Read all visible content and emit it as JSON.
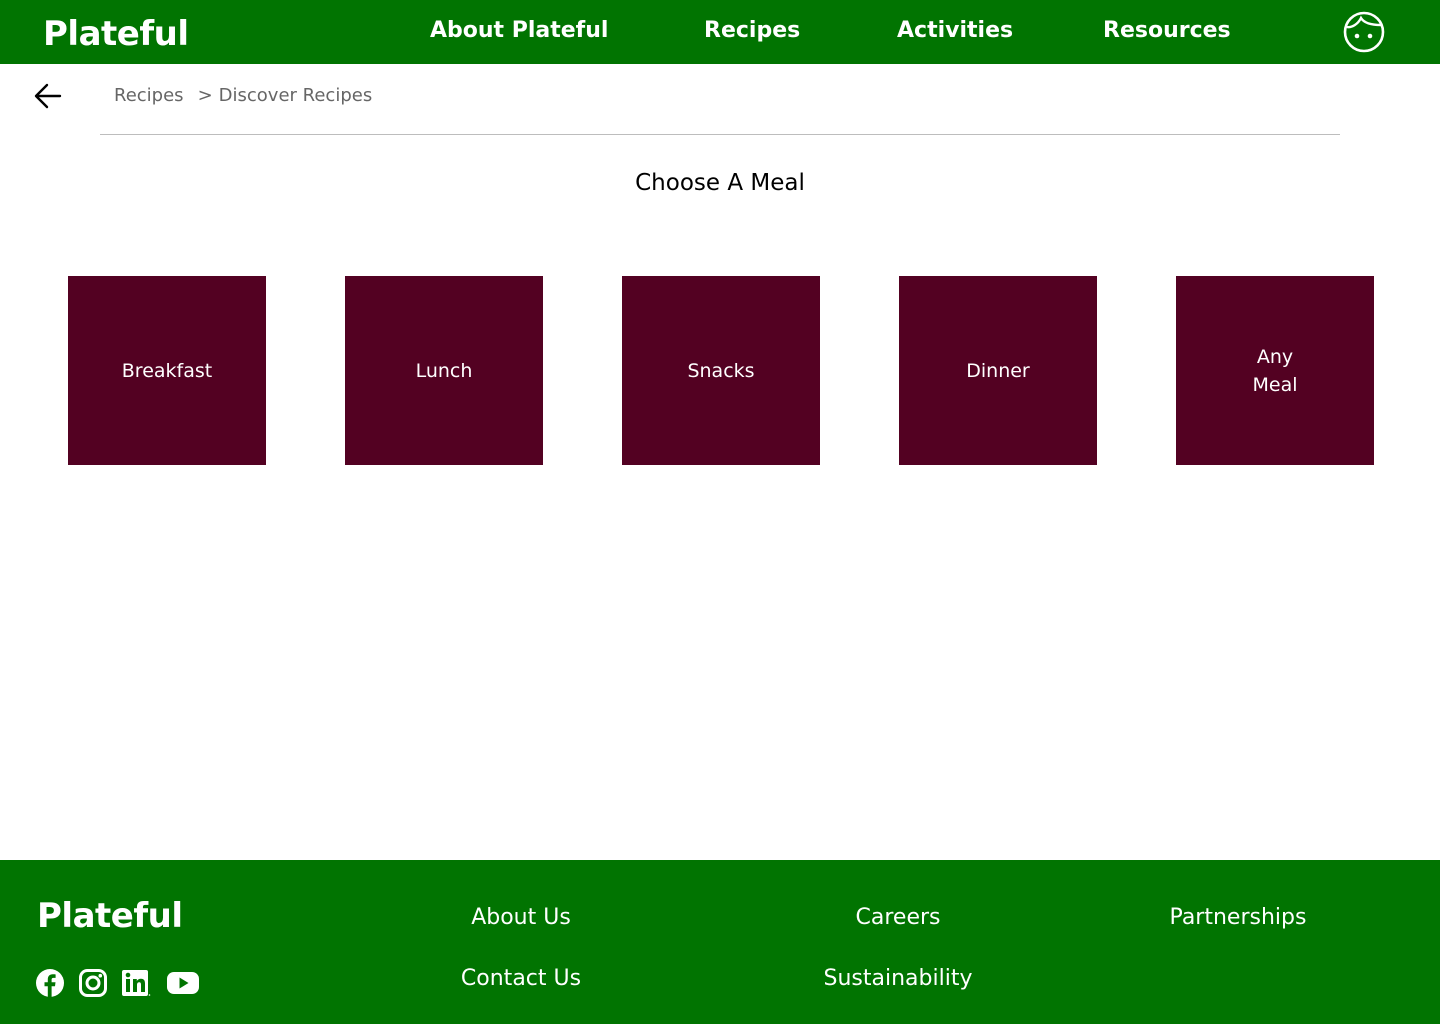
{
  "brand": {
    "name": "Plateful",
    "primary_color": "#017401",
    "tile_color": "#530122"
  },
  "header": {
    "logo": "Plateful",
    "nav": [
      {
        "label": "About Plateful"
      },
      {
        "label": "Recipes"
      },
      {
        "label": "Activities"
      },
      {
        "label": "Resources"
      }
    ],
    "profile_icon": "face-icon"
  },
  "breadcrumb": {
    "back_icon": "arrow-left-icon",
    "items": [
      "Recipes",
      "Discover Recipes"
    ],
    "separator": ">"
  },
  "main": {
    "title": "Choose A Meal",
    "meals": [
      {
        "label": "Breakfast"
      },
      {
        "label": "Lunch"
      },
      {
        "label": "Snacks"
      },
      {
        "label": "Dinner"
      },
      {
        "label": "Any\nMeal"
      }
    ]
  },
  "footer": {
    "logo": "Plateful",
    "links": {
      "about": "About Us",
      "contact": "Contact Us",
      "careers": "Careers",
      "sustainability": "Sustainability",
      "partnerships": "Partnerships"
    },
    "social_icons": [
      "facebook-icon",
      "instagram-icon",
      "linkedin-icon",
      "youtube-icon"
    ]
  }
}
